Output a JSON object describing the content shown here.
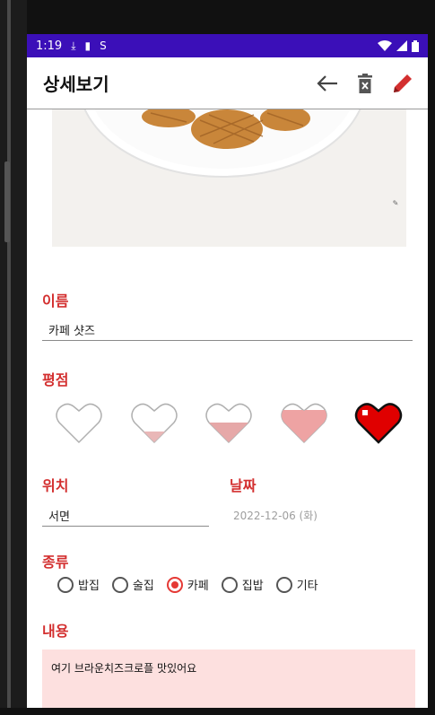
{
  "status_bar": {
    "time": "1:19"
  },
  "app_bar": {
    "title": "상세보기"
  },
  "fields": {
    "name": {
      "label": "이름",
      "value": "카페 샷즈"
    },
    "rating": {
      "label": "평점",
      "value": 5,
      "max": 5
    },
    "location": {
      "label": "위치",
      "value": "서면"
    },
    "date": {
      "label": "날짜",
      "value": "2022-12-06 (화)"
    },
    "category": {
      "label": "종류",
      "options": [
        "밥집",
        "술집",
        "카페",
        "집밥",
        "기타"
      ],
      "selected": "카페"
    },
    "content": {
      "label": "내용",
      "value": "여기 브라운치즈크로플 맛있어요"
    }
  },
  "colors": {
    "status_bar": "#3b0fb8",
    "accent": "#d32f2f",
    "heart_filled": "#e00000",
    "content_bg": "#fde0df"
  }
}
